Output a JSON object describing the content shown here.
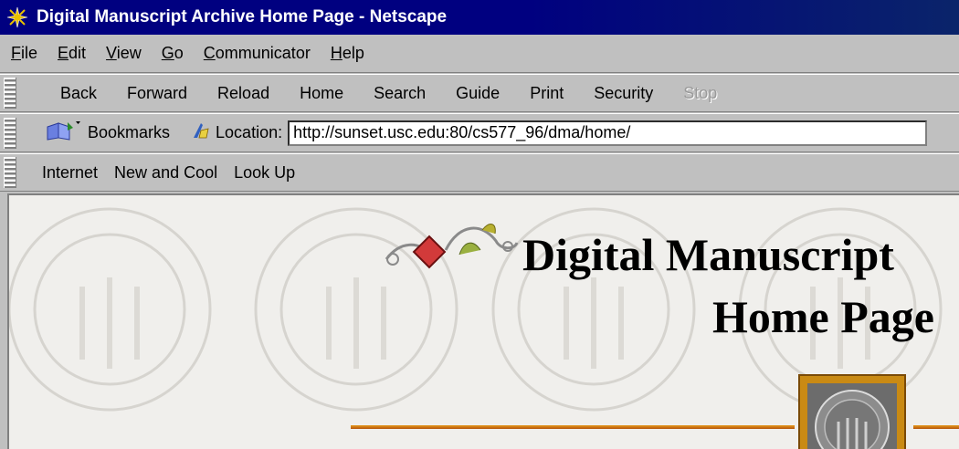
{
  "window": {
    "title": "Digital Manuscript Archive Home Page - Netscape",
    "app_icon": "netscape-icon"
  },
  "menu": [
    {
      "label": "File",
      "accel": "F",
      "rest": "ile"
    },
    {
      "label": "Edit",
      "accel": "E",
      "rest": "dit"
    },
    {
      "label": "View",
      "accel": "V",
      "rest": "iew"
    },
    {
      "label": "Go",
      "accel": "G",
      "rest": "o"
    },
    {
      "label": "Communicator",
      "accel": "C",
      "rest": "ommunicator"
    },
    {
      "label": "Help",
      "accel": "H",
      "rest": "elp"
    }
  ],
  "nav_toolbar": {
    "back": "Back",
    "forward": "Forward",
    "reload": "Reload",
    "home": "Home",
    "search": "Search",
    "guide": "Guide",
    "print": "Print",
    "security": "Security",
    "stop": "Stop"
  },
  "location_bar": {
    "bookmarks_label": "Bookmarks",
    "location_label": "Location:",
    "url": "http://sunset.usc.edu:80/cs577_96/dma/home/"
  },
  "personal_toolbar": {
    "items": [
      "Internet",
      "New and Cool",
      "Look Up"
    ]
  },
  "page": {
    "heading_line1": "Digital Manuscript",
    "heading_line2": "Home Page",
    "colors": {
      "rule": "#d77a12",
      "background": "#f0efec"
    }
  }
}
